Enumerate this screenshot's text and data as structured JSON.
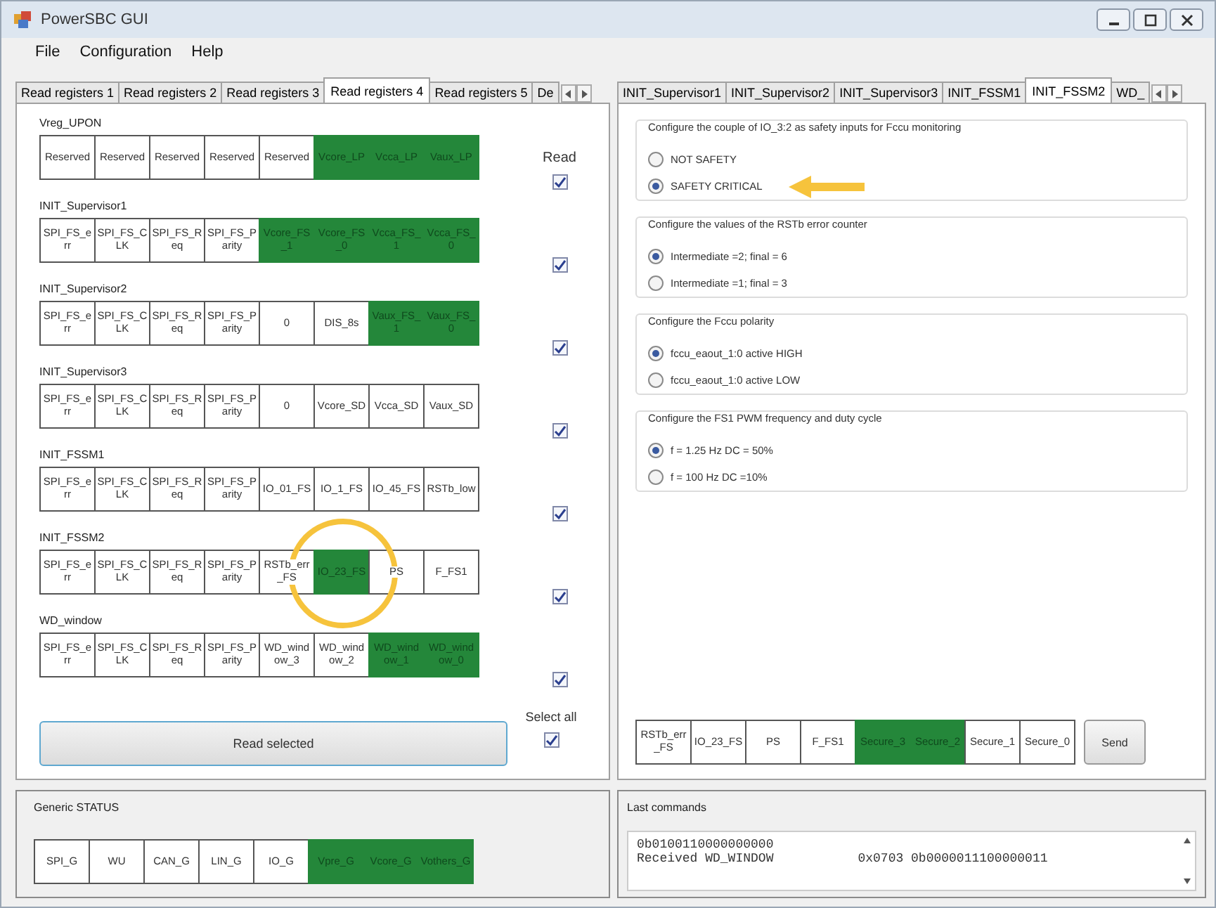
{
  "window": {
    "title": "PowerSBC GUI"
  },
  "menu": [
    "File",
    "Configuration",
    "Help"
  ],
  "left_tabs": [
    {
      "label": "Read registers 1",
      "selected": false
    },
    {
      "label": "Read registers 2",
      "selected": false
    },
    {
      "label": "Read registers 3",
      "selected": false
    },
    {
      "label": "Read registers 4",
      "selected": true
    },
    {
      "label": "Read registers 5",
      "selected": false
    },
    {
      "label": "De",
      "selected": false
    }
  ],
  "read_header": "Read",
  "registers": [
    {
      "title": "Vreg_UPON",
      "read": true,
      "bits": [
        {
          "label": "Reserved",
          "on": false
        },
        {
          "label": "Reserved",
          "on": false
        },
        {
          "label": "Reserved",
          "on": false
        },
        {
          "label": "Reserved",
          "on": false
        },
        {
          "label": "Reserved",
          "on": false
        },
        {
          "label": "Vcore_LP",
          "on": true
        },
        {
          "label": "Vcca_LP",
          "on": true
        },
        {
          "label": "Vaux_LP",
          "on": true
        }
      ]
    },
    {
      "title": "INIT_Supervisor1",
      "read": true,
      "bits": [
        {
          "label": "SPI_FS_err",
          "on": false
        },
        {
          "label": "SPI_FS_CLK",
          "on": false
        },
        {
          "label": "SPI_FS_Req",
          "on": false
        },
        {
          "label": "SPI_FS_Parity",
          "on": false
        },
        {
          "label": "Vcore_FS_1",
          "on": true
        },
        {
          "label": "Vcore_FS_0",
          "on": true
        },
        {
          "label": "Vcca_FS_1",
          "on": true
        },
        {
          "label": "Vcca_FS_0",
          "on": true
        }
      ]
    },
    {
      "title": "INIT_Supervisor2",
      "read": true,
      "bits": [
        {
          "label": "SPI_FS_err",
          "on": false
        },
        {
          "label": "SPI_FS_CLK",
          "on": false
        },
        {
          "label": "SPI_FS_Req",
          "on": false
        },
        {
          "label": "SPI_FS_Parity",
          "on": false
        },
        {
          "label": "0",
          "on": false
        },
        {
          "label": "DIS_8s",
          "on": false
        },
        {
          "label": "Vaux_FS_1",
          "on": true
        },
        {
          "label": "Vaux_FS_0",
          "on": true
        }
      ]
    },
    {
      "title": "INIT_Supervisor3",
      "read": true,
      "bits": [
        {
          "label": "SPI_FS_err",
          "on": false
        },
        {
          "label": "SPI_FS_CLK",
          "on": false
        },
        {
          "label": "SPI_FS_Req",
          "on": false
        },
        {
          "label": "SPI_FS_Parity",
          "on": false
        },
        {
          "label": "0",
          "on": false
        },
        {
          "label": "Vcore_SD",
          "on": false
        },
        {
          "label": "Vcca_SD",
          "on": false
        },
        {
          "label": "Vaux_SD",
          "on": false
        }
      ]
    },
    {
      "title": "INIT_FSSM1",
      "read": true,
      "bits": [
        {
          "label": "SPI_FS_err",
          "on": false
        },
        {
          "label": "SPI_FS_CLK",
          "on": false
        },
        {
          "label": "SPI_FS_Req",
          "on": false
        },
        {
          "label": "SPI_FS_Parity",
          "on": false
        },
        {
          "label": "IO_01_FS",
          "on": false
        },
        {
          "label": "IO_1_FS",
          "on": false
        },
        {
          "label": "IO_45_FS",
          "on": false
        },
        {
          "label": "RSTb_low",
          "on": false
        }
      ]
    },
    {
      "title": "INIT_FSSM2",
      "read": true,
      "bits": [
        {
          "label": "SPI_FS_err",
          "on": false
        },
        {
          "label": "SPI_FS_CLK",
          "on": false
        },
        {
          "label": "SPI_FS_Req",
          "on": false
        },
        {
          "label": "SPI_FS_Parity",
          "on": false
        },
        {
          "label": "RSTb_err_FS",
          "on": false
        },
        {
          "label": "IO_23_FS",
          "on": true,
          "circled": true
        },
        {
          "label": "PS",
          "on": false
        },
        {
          "label": "F_FS1",
          "on": false
        }
      ]
    },
    {
      "title": "WD_window",
      "read": true,
      "bits": [
        {
          "label": "SPI_FS_err",
          "on": false
        },
        {
          "label": "SPI_FS_CLK",
          "on": false
        },
        {
          "label": "SPI_FS_Req",
          "on": false
        },
        {
          "label": "SPI_FS_Parity",
          "on": false
        },
        {
          "label": "WD_window_3",
          "on": false
        },
        {
          "label": "WD_window_2",
          "on": false
        },
        {
          "label": "WD_window_1",
          "on": true
        },
        {
          "label": "WD_window_0",
          "on": true
        }
      ]
    }
  ],
  "read_button": "Read selected",
  "select_all": {
    "label": "Select all",
    "checked": true
  },
  "status": {
    "title": "Generic STATUS",
    "bits": [
      {
        "label": "SPI_G",
        "on": false
      },
      {
        "label": "WU",
        "on": false
      },
      {
        "label": "CAN_G",
        "on": false
      },
      {
        "label": "LIN_G",
        "on": false
      },
      {
        "label": "IO_G",
        "on": false
      },
      {
        "label": "Vpre_G",
        "on": true
      },
      {
        "label": "Vcore_G",
        "on": true
      },
      {
        "label": "Vothers_G",
        "on": true
      }
    ]
  },
  "right_tabs": [
    {
      "label": "INIT_Supervisor1",
      "selected": false
    },
    {
      "label": "INIT_Supervisor2",
      "selected": false
    },
    {
      "label": "INIT_Supervisor3",
      "selected": false
    },
    {
      "label": "INIT_FSSM1",
      "selected": false
    },
    {
      "label": "INIT_FSSM2",
      "selected": true
    },
    {
      "label": "WD_",
      "selected": false
    }
  ],
  "config_groups": [
    {
      "title": "Configure the couple of IO_3:2 as safety inputs for Fccu monitoring",
      "options": [
        {
          "label": "NOT SAFETY",
          "selected": false
        },
        {
          "label": "SAFETY CRITICAL",
          "selected": true,
          "arrow": true
        }
      ]
    },
    {
      "title": "Configure the values of the RSTb error counter",
      "options": [
        {
          "label": "Intermediate =2; final = 6",
          "selected": true
        },
        {
          "label": "Intermediate =1; final = 3",
          "selected": false
        }
      ]
    },
    {
      "title": "Configure the Fccu polarity",
      "options": [
        {
          "label": "fccu_eaout_1:0 active HIGH",
          "selected": true
        },
        {
          "label": "fccu_eaout_1:0 active LOW",
          "selected": false
        }
      ]
    },
    {
      "title": "Configure the FS1 PWM frequency and duty cycle",
      "options": [
        {
          "label": "f = 1.25 Hz DC = 50%",
          "selected": true
        },
        {
          "label": "f = 100 Hz DC =10%",
          "selected": false
        }
      ]
    }
  ],
  "send_bits": [
    {
      "label": "RSTb_err_FS",
      "on": false
    },
    {
      "label": "IO_23_FS",
      "on": false
    },
    {
      "label": "PS",
      "on": false
    },
    {
      "label": "F_FS1",
      "on": false
    },
    {
      "label": "Secure_3",
      "on": true
    },
    {
      "label": "Secure_2",
      "on": true
    },
    {
      "label": "Secure_1",
      "on": false
    },
    {
      "label": "Secure_0",
      "on": false
    }
  ],
  "send_button": "Send",
  "last_commands": {
    "title": "Last commands",
    "lines": [
      {
        "columns": [
          "0b0100110000000000"
        ]
      },
      {
        "columns": [
          "Received WD_WINDOW",
          "0x0703 0b0000011100000011"
        ]
      }
    ]
  }
}
